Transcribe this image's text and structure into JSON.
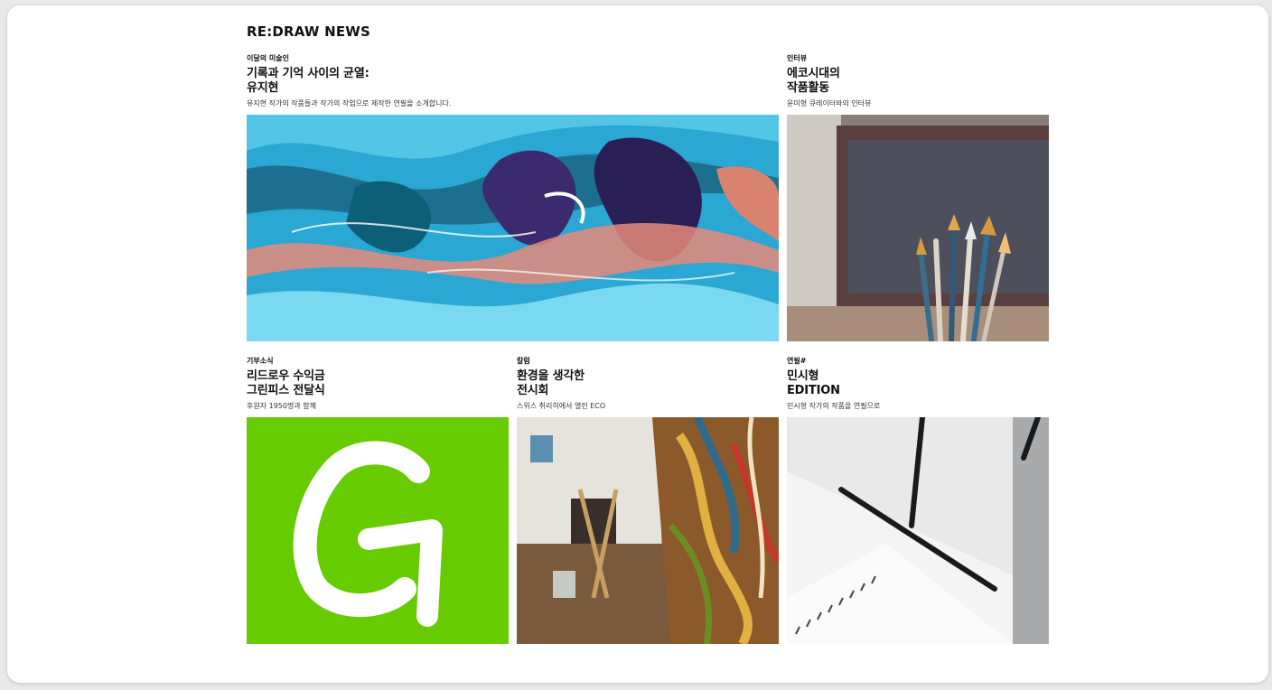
{
  "site": {
    "title": "RE:DRAW NEWS"
  },
  "articles": [
    {
      "category": "이달의 미술인",
      "title": "기록과 기억 사이의 균열:\n유지현",
      "description": "유지현 작가의 작품들과 작가의 작업으로 제작한 연필을 소개합니다.",
      "image": "fluid-art-image"
    },
    {
      "category": "인터뷰",
      "title": "에코시대의\n작품활동",
      "description": "윤미형 큐레이터와의 인터뷰",
      "image": "paint-brushes-image"
    },
    {
      "category": "기부소식",
      "title": "리드로우 수익금\n그린피스 전달식",
      "description": "후원자 1950명과 함께",
      "image": "greenpeace-logo-image"
    },
    {
      "category": "칼럼",
      "title": "환경을 생각한\n전시회",
      "description": "스위스 취리히에서 열린 ECO",
      "image": "exhibition-painting-image"
    },
    {
      "category": "연필#",
      "title": "민시형\nEDITION",
      "description": "민시형 작가의 작품을 연필으로",
      "image": "sketchbook-pencils-image"
    }
  ],
  "colors": {
    "greenpeace": "#66cc00",
    "accent_blue": "#2fb6e0"
  }
}
